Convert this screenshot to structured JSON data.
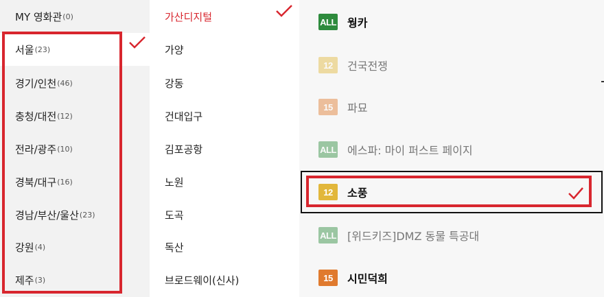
{
  "colors": {
    "accent": "#d8262e",
    "rating_all": "#2e8b3d",
    "rating_12": "#e2b73b",
    "rating_15": "#e07a2e"
  },
  "regions": [
    {
      "label": "MY 영화관",
      "count": "(0)"
    },
    {
      "label": "서울",
      "count": "(23)"
    },
    {
      "label": "경기/인천",
      "count": "(46)"
    },
    {
      "label": "충청/대전",
      "count": "(12)"
    },
    {
      "label": "전라/광주",
      "count": "(10)"
    },
    {
      "label": "경북/대구",
      "count": "(16)"
    },
    {
      "label": "경남/부산/울산",
      "count": "(23)"
    },
    {
      "label": "강원",
      "count": "(4)"
    },
    {
      "label": "제주",
      "count": "(3)"
    }
  ],
  "theaters": [
    "가산디지털",
    "가양",
    "강동",
    "건대입구",
    "김포공항",
    "노원",
    "도곡",
    "독산",
    "브로드웨이(신사)"
  ],
  "movies": [
    {
      "rating": "ALL",
      "title": "웡카"
    },
    {
      "rating": "12",
      "title": "건국전쟁"
    },
    {
      "rating": "15",
      "title": "파묘"
    },
    {
      "rating": "ALL",
      "title": "에스파: 마이 퍼스트 페이지"
    },
    {
      "rating": "12",
      "title": "소풍"
    },
    {
      "rating": "ALL",
      "title": "[위드키즈]DMZ 동물 특공대"
    },
    {
      "rating": "15",
      "title": "시민덕희"
    }
  ],
  "icons": {
    "check": "check-icon"
  }
}
